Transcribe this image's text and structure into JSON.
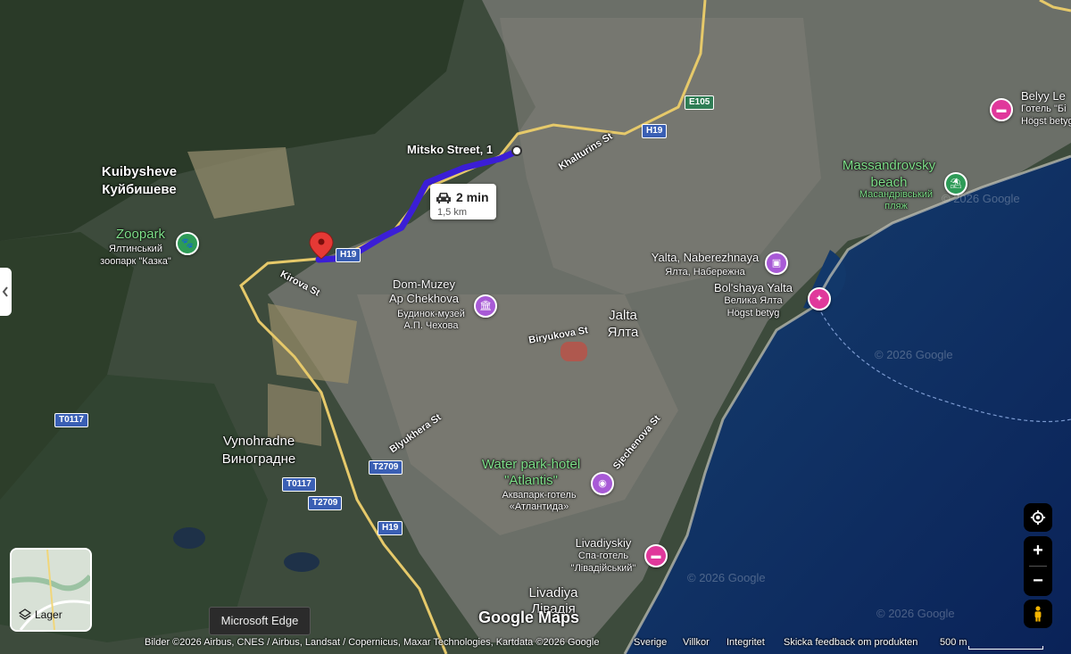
{
  "map": {
    "title": "Google Maps",
    "watermark": "Google Maps"
  },
  "route": {
    "origin_label": "Mitsko Street, 1",
    "time": "2 min",
    "distance": "1,5 km",
    "road": "H19"
  },
  "places": {
    "kuibysheve_en": "Kuibysheve",
    "kuibysheve_ua": "Куйбишеве",
    "zoopark_en": "Zoopark",
    "zoopark_ua1": "Ялтинський",
    "zoopark_ua2": "зоопарк \"Казка\"",
    "chekhov_en1": "Dom-Muzey",
    "chekhov_en2": "Ap Chekhova",
    "chekhov_ua1": "Будинок-музей",
    "chekhov_ua2": "А.П. Чехова",
    "jalta_en": "Jalta",
    "jalta_ua": "Ялта",
    "naberezhnaya_en": "Yalta, Naberezhnaya",
    "naberezhnaya_ua": "Ялта, Набережна",
    "bolshaya_en": "Bol'shaya Yalta",
    "bolshaya_ua": "Велика Ялта",
    "bolshaya_rating": "Högst betyg",
    "massandra_en1": "Massandrovsky",
    "massandra_en2": "beach",
    "massandra_ua1": "Масандрівський",
    "massandra_ua2": "пляж",
    "belyy_en": "Belyy Le",
    "belyy_ua": "Готель \"Бі",
    "belyy_rating": "Högst betyg",
    "vynohradne_en": "Vynohradne",
    "vynohradne_ua": "Виноградне",
    "waterpark_en1": "Water park-hotel",
    "waterpark_en2": "\"Atlantis\"",
    "waterpark_ua1": "Аквапарк-готель",
    "waterpark_ua2": "«Атлантида»",
    "livadiyskiy_en": "Livadiyskiy",
    "livadiyskiy_ua1": "Спа-готель",
    "livadiyskiy_ua2": "\"Лівадійський\"",
    "livadiya_en": "Livadiya",
    "livadiya_ua": "Лівадія"
  },
  "streets": {
    "kirova": "Kirova St",
    "khalturins": "Khalturins St",
    "biryukova": "Biryukova St",
    "blyukhera": "Blyukhera St",
    "sjechenova": "Sjechenova St"
  },
  "shields": {
    "e105": "E105",
    "h19_a": "H19",
    "h19_b": "H19",
    "h19_c": "H19",
    "t0117_a": "T0117",
    "t0117_b": "T0117",
    "t2709_a": "T2709",
    "t2709_b": "T2709"
  },
  "watermarks": {
    "w1": "© 2026 Google",
    "w2": "© 2026 Google",
    "w3": "© 2026 Google",
    "w4": "© 2026 Google"
  },
  "controls": {
    "layers_label": "Lager",
    "tooltip": "Microsoft Edge",
    "zoom_in": "+",
    "zoom_out": "−"
  },
  "footer": {
    "attribution": "Bilder ©2026 Airbus, CNES / Airbus, Landsat / Copernicus, Maxar Technologies, Kartdata ©2026 Google",
    "country": "Sverige",
    "terms": "Villkor",
    "privacy": "Integritet",
    "feedback": "Skicka feedback om produkten",
    "scale": "500 m"
  },
  "colors": {
    "route": "#3b1ed6",
    "sea": "#0e2a66",
    "land": "#3c4a3a",
    "hotel_pin": "#e0389b",
    "attraction_pin": "#a85ad6",
    "beach_pin": "#2e9b57"
  }
}
